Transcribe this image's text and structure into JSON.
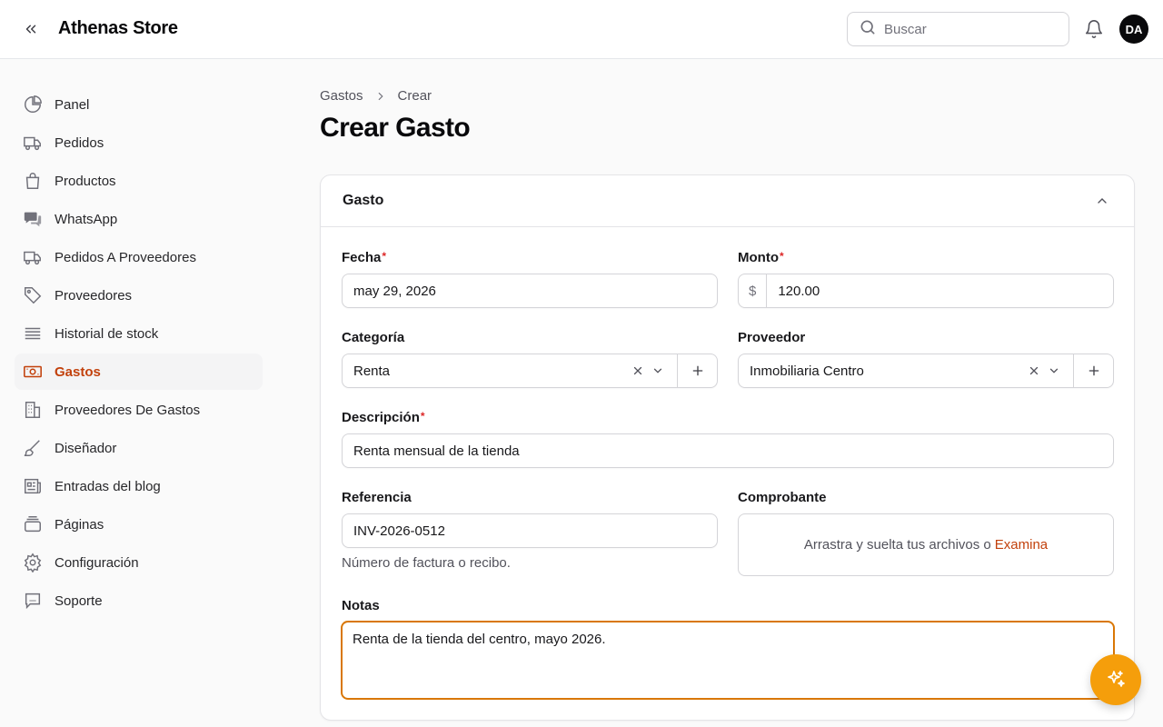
{
  "header": {
    "brand": "Athenas Store",
    "search_placeholder": "Buscar",
    "avatar_initials": "DA"
  },
  "sidebar": {
    "items": [
      {
        "label": "Panel",
        "icon": "pie-chart-icon"
      },
      {
        "label": "Pedidos",
        "icon": "truck-icon"
      },
      {
        "label": "Productos",
        "icon": "shopping-bag-icon"
      },
      {
        "label": "WhatsApp",
        "icon": "chat-bubbles-icon"
      },
      {
        "label": "Pedidos A Proveedores",
        "icon": "truck-icon"
      },
      {
        "label": "Proveedores",
        "icon": "tag-icon"
      },
      {
        "label": "Historial de stock",
        "icon": "stack-icon"
      },
      {
        "label": "Gastos",
        "icon": "banknotes-icon",
        "active": true
      },
      {
        "label": "Proveedores De Gastos",
        "icon": "building-icon"
      },
      {
        "label": "Diseñador",
        "icon": "paintbrush-icon"
      },
      {
        "label": "Entradas del blog",
        "icon": "newspaper-icon"
      },
      {
        "label": "Páginas",
        "icon": "pages-icon"
      },
      {
        "label": "Configuración",
        "icon": "gear-icon"
      },
      {
        "label": "Soporte",
        "icon": "support-chat-icon"
      }
    ]
  },
  "breadcrumb": {
    "parent": "Gastos",
    "current": "Crear"
  },
  "page": {
    "title": "Crear Gasto"
  },
  "form": {
    "section_title": "Gasto",
    "fecha": {
      "label": "Fecha",
      "value": "may 29, 2026"
    },
    "monto": {
      "label": "Monto",
      "prefix": "$",
      "value": "120.00"
    },
    "categoria": {
      "label": "Categoría",
      "value": "Renta"
    },
    "proveedor": {
      "label": "Proveedor",
      "value": "Inmobiliaria Centro"
    },
    "descripcion": {
      "label": "Descripción",
      "value": "Renta mensual de la tienda"
    },
    "referencia": {
      "label": "Referencia",
      "value": "INV-2026-0512",
      "hint": "Número de factura o recibo."
    },
    "comprobante": {
      "label": "Comprobante",
      "drop_text": "Arrastra y suelta tus archivos o",
      "browse": "Examina"
    },
    "notas": {
      "label": "Notas",
      "value": "Renta de la tienda del centro, mayo 2026."
    },
    "required_mark": "*"
  },
  "colors": {
    "accent": "#c2410c",
    "fab": "#f59e0b",
    "focus": "#d97706"
  }
}
